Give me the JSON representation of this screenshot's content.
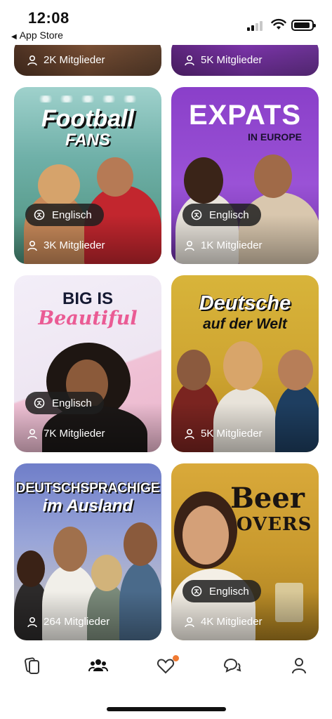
{
  "status_bar": {
    "time": "12:08",
    "back_label": "App Store"
  },
  "groups": [
    {
      "id": "top-left",
      "members": "2K Mitglieder"
    },
    {
      "id": "top-right",
      "members": "5K Mitglieder"
    },
    {
      "id": "football",
      "title_line1": "Football",
      "title_line2": "FANS",
      "language": "Englisch",
      "members": "3K Mitglieder"
    },
    {
      "id": "expats",
      "title_line1": "EXPATS",
      "title_line2": "IN EUROPE",
      "language": "Englisch",
      "members": "1K Mitglieder"
    },
    {
      "id": "big",
      "title_line1": "BIG IS",
      "title_line2": "Beautiful",
      "language": "Englisch",
      "members": "7K Mitglieder"
    },
    {
      "id": "deutsche",
      "title_line1": "Deutsche",
      "title_line2": "auf der Welt",
      "members": "5K Mitglieder"
    },
    {
      "id": "deutschsprachige",
      "title_line1": "DEUTSCHSPRACHIGE",
      "title_line2": "im Ausland",
      "members": "264 Mitglieder"
    },
    {
      "id": "beer",
      "title_line1": "Beer",
      "title_line2": "LOVERS",
      "language": "Englisch",
      "members": "4K Mitglieder"
    }
  ],
  "tab_bar": {
    "tabs": [
      {
        "name": "cards-icon"
      },
      {
        "name": "community-icon",
        "active": true
      },
      {
        "name": "likes-icon",
        "has_badge": true
      },
      {
        "name": "chat-icon"
      },
      {
        "name": "profile-icon"
      }
    ]
  },
  "colors": {
    "accent": "#f07a32",
    "chip_bg": "#1e1e1e",
    "expats_purple": "#8a3fc9",
    "deutsche_yellow": "#d8b43a"
  }
}
